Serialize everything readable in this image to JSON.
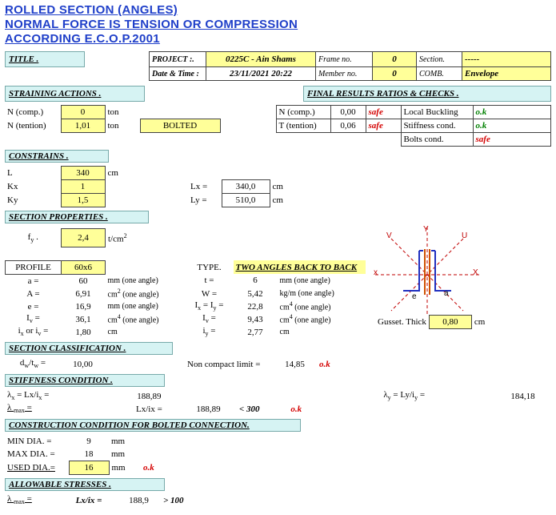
{
  "headings": {
    "h1": "ROLLED SECTION (ANGLES)",
    "h2": "NORMAL FORCE IS TENSION OR COMPRESSION",
    "h3": "ACCORDING  E.C.O.P.2001"
  },
  "title_block": {
    "title_label": "TITLE .",
    "project_label": "PROJECT :.",
    "project": "0225C - Ain Shams",
    "datetime_label": "Date & Time :",
    "datetime": "23/11/2021 20:22",
    "frame_label": "Frame no.",
    "frame": "0",
    "member_label": "Member no.",
    "member": "0",
    "section_label": "Section.",
    "section": "-----",
    "comb_label": "COMB.",
    "comb": "Envelope"
  },
  "straining_header": "STRAINING ACTIONS .",
  "results_header": "FINAL RESULTS RATIOS & CHECKS .",
  "straining": {
    "ncomp_label": "N (comp.)",
    "ncomp": "0",
    "ncomp_unit": "ton",
    "ntens_label": "N (tention)",
    "ntens": "1,01",
    "ntens_unit": "ton",
    "bolted": "BOLTED"
  },
  "results": {
    "ncomp_label": "N (comp.)",
    "ncomp": "0,00",
    "ncomp_state": "safe",
    "loc_buck_label": "Local Buckling",
    "loc_buck_state": "o.k",
    "ttens_label": "T (tention)",
    "ttens": "0,06",
    "ttens_state": "safe",
    "stiff_label": "Stiffness cond.",
    "stiff_state": "o.k",
    "bolts_label": "Bolts cond.",
    "bolts_state": "safe"
  },
  "constrains_header": "CONSTRAINS .",
  "constrains": {
    "L_label": "L",
    "L": "340",
    "L_unit": "cm",
    "Kx_label": "Kx",
    "Kx": "1",
    "Lx_label": "Lx  =",
    "Lx": "340,0",
    "Lx_unit": "cm",
    "Ky_label": "Ky",
    "Ky": "1,5",
    "Ly_label": "Ly  =",
    "Ly": "510,0",
    "Ly_unit": "cm"
  },
  "secprops_header": "SECTION PROPERTIES .",
  "secprops": {
    "fy_label": "f",
    "fy_sub": "y",
    "fy_tail": " .",
    "fy": "2,4",
    "fy_unit": "t/cm",
    "fy_sup": "2",
    "profile_label": "PROFILE",
    "profile": "60x6",
    "type_label": "TYPE.",
    "type": "TWO ANGLES BACK TO BACK",
    "a_label": "a  =",
    "a": "60",
    "a_unit": "mm  (one angle)",
    "A_label": "A  =",
    "A": "6,91",
    "A_unit_pre": "cm",
    "A_sup": "2",
    "A_unit_post": " (one angle)",
    "e_label": "e  =",
    "e": "16,9",
    "e_unit": "mm  (one angle)",
    "Iv_label": "I",
    "Iv_sub": "v",
    "Iv_tail": " =",
    "Iv": "36,1",
    "Iv_unit_pre": "cm",
    "Iv_sup": "4",
    "Iv_unit_post": " (one angle)",
    "ixiv_label": "i",
    "ixiv_sub1": "x",
    "ixiv_mid": "  or  i",
    "ixiv_sub2": "v",
    "ixiv_tail": "  =",
    "ixiv": "1,80",
    "ixiv_unit": "cm",
    "t_label": "t  =",
    "t": "6",
    "t_unit": "mm  (one angle)",
    "W_label": "W  =",
    "W": "5,42",
    "W_unit": "kg/m  (one angle)",
    "IxIy_label": "I",
    "IxIy_sub1": "x",
    "IxIy_mid": " = I",
    "IxIy_sub2": "y",
    "IxIy_tail": " =",
    "IxIy": "22,8",
    "IxIy_unit_pre": "cm",
    "IxIy_sup": "4",
    "IxIy_unit_post": " (one angle)",
    "Iv2_label": "I",
    "Iv2_sub": "v",
    "Iv2_tail": " =",
    "Iv2": "9,43",
    "Iv2_unit_pre": "cm",
    "Iv2_sup": "4",
    "Iv2_unit_post": " (one angle)",
    "iy_label": "i",
    "iy_sub": "y",
    "iy_tail": " =",
    "iy": "2,77",
    "iy_unit": "cm",
    "guss_label": "Gusset. Thick",
    "guss": "0,80",
    "guss_unit": "cm"
  },
  "diagram": {
    "Y": "Y",
    "X": "X",
    "U": "U",
    "V": "V",
    "a": "a",
    "e": "e",
    "x": "x"
  },
  "class_header": "SECTION CLASSIFICATION .",
  "classification": {
    "dwtw_label": "d",
    "dwtw_sub1": "w",
    "dwtw_mid": "/t",
    "dwtw_sub2": "w",
    "dwtw_tail": "  =",
    "dwtw": "10,00",
    "lim_label": "Non compact limit =",
    "lim": "14,85",
    "state": "o.k"
  },
  "stiff_header": "STIFFNESS CONDITION .",
  "stiff": {
    "lx_label": "λ",
    "lx_sub": "x",
    "lx_mid": " =  Lx/i",
    "lx_sub2": "x",
    "lx_tail": " =",
    "lx": "188,89",
    "ly_label": "λ",
    "ly_sub": "y",
    "ly_mid": " =  Ly/i",
    "ly_sub2": "y",
    "ly_tail": " =",
    "ly": "184,18",
    "lmax_label": "λ ",
    "lmax_sub": "max",
    "lmax_mid": " =",
    "lmax_expr": "Lx/ix  =",
    "lmax": "188,89",
    "lim": "< 300",
    "state": "o.k"
  },
  "bolt_header": "CONSTRUCTION CONDITION FOR BOLTED CONNECTION.",
  "bolt": {
    "min_label": "MIN DIA.   =",
    "min": "9",
    "min_unit": "mm",
    "max_label": "MAX DIA.  =",
    "max": "18",
    "max_unit": "mm",
    "used_label": "USED DIA.=",
    "used": "16",
    "used_unit": "mm",
    "state": "o.k"
  },
  "allow_header": "ALLOWABLE STRESSES .",
  "allow": {
    "lmax_label": "λ ",
    "lmax_sub": "max",
    "lmax_tail": " =",
    "expr": "Lx/ix  =",
    "val": "188,9",
    "lim": "> 100"
  }
}
